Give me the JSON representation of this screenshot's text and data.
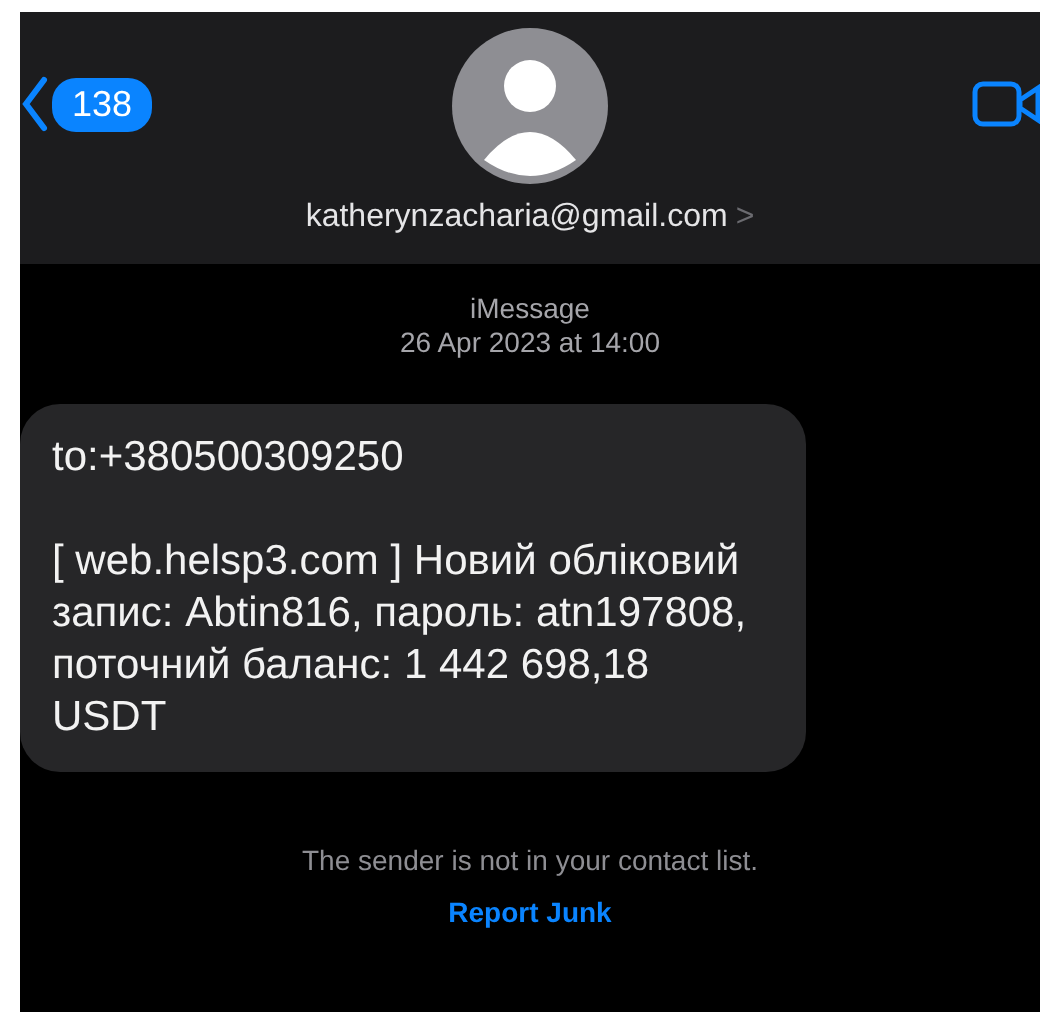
{
  "header": {
    "back_count": "138",
    "contact": "katherynzacharia@gmail.com",
    "chevron": ">"
  },
  "meta": {
    "service": "iMessage",
    "timestamp": "26 Apr 2023 at 14:00"
  },
  "messages": [
    {
      "paragraphs": [
        "to:+380500309250",
        "[ web.helsp3.com ] Новий обліковий запис: Abtin816, пароль: atn197808, поточний баланс: 1 442 698,18 USDT"
      ]
    }
  ],
  "notice": "The sender is not in your contact list.",
  "report_link": "Report Junk"
}
